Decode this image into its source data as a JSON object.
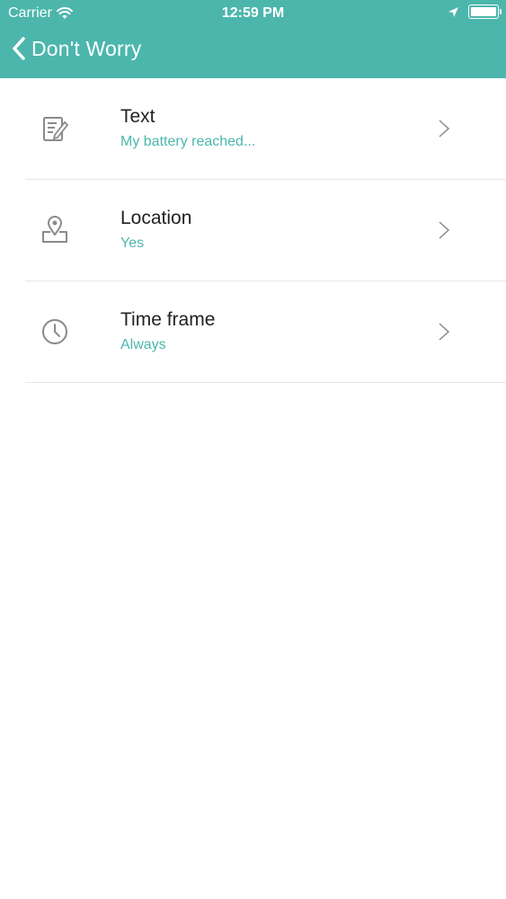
{
  "status_bar": {
    "carrier": "Carrier",
    "time": "12:59 PM"
  },
  "nav": {
    "back_title": "Don't Worry"
  },
  "rows": [
    {
      "title": "Text",
      "subtitle": "My battery reached...",
      "icon": "edit-note-icon"
    },
    {
      "title": "Location",
      "subtitle": "Yes",
      "icon": "location-pin-icon"
    },
    {
      "title": "Time frame",
      "subtitle": "Always",
      "icon": "clock-icon"
    }
  ],
  "colors": {
    "accent": "#4cb6ac",
    "divider": "#e6e6e6",
    "icon": "#8a8a8a"
  }
}
